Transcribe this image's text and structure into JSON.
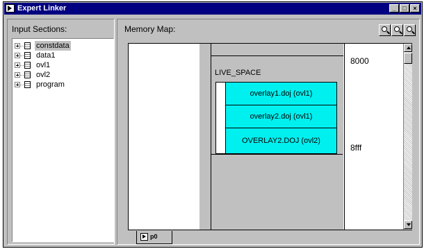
{
  "window": {
    "title": "Expert Linker",
    "minimize": "_",
    "maximize": "□",
    "close": "×"
  },
  "left": {
    "title": "Input Sections:",
    "items": [
      {
        "label": "constdata",
        "selected": true
      },
      {
        "label": "data1"
      },
      {
        "label": "ovl1"
      },
      {
        "label": "ovl2"
      },
      {
        "label": "program"
      }
    ]
  },
  "right": {
    "title": "Memory Map:",
    "memory": {
      "segment_label": "LIVE_SPACE",
      "overlays": [
        {
          "label": "overlay1.doj (ovl1)"
        },
        {
          "label": "overlay2.doj (ovl1)"
        },
        {
          "label": "OVERLAY2.DOJ (ovl2)"
        }
      ],
      "start_address": "8000",
      "end_address": "8fff"
    },
    "tab": {
      "label": "p0"
    }
  }
}
